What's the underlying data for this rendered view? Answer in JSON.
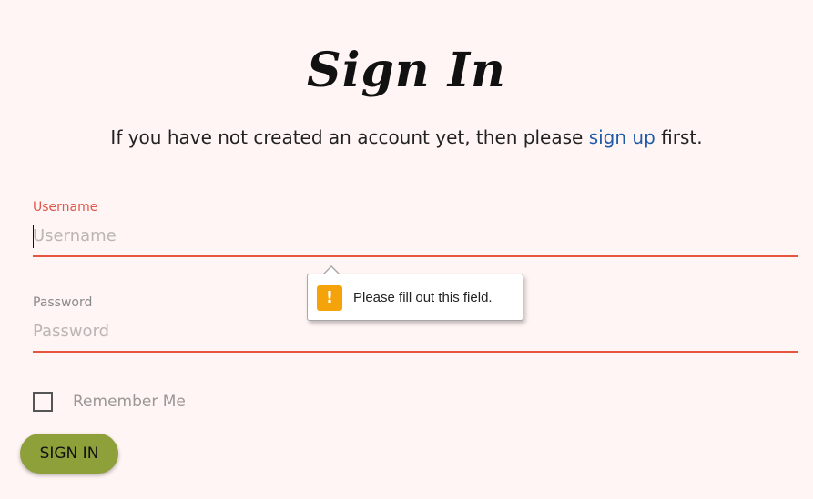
{
  "header": {
    "title": "Sign In",
    "intro_before": "If you have not created an account yet, then please ",
    "intro_link": "sign up",
    "intro_after": " first."
  },
  "form": {
    "username": {
      "label": "Username",
      "placeholder": "Username",
      "value": ""
    },
    "password": {
      "label": "Password",
      "placeholder": "Password",
      "value": ""
    },
    "remember_label": "Remember Me",
    "remember_checked": false,
    "submit_label": "SIGN IN"
  },
  "validation_tooltip": {
    "icon": "warning-icon",
    "message": "Please fill out this field."
  },
  "colors": {
    "background": "#fff5f4",
    "accent_underline": "#e8553e",
    "link": "#1e5aa8",
    "button": "#8ea03a",
    "warning": "#f5a30a"
  }
}
